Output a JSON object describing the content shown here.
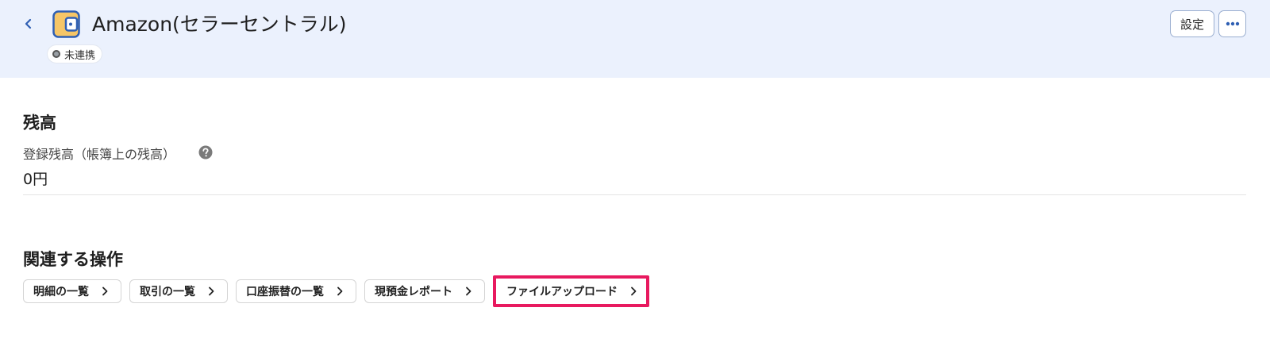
{
  "header": {
    "title": "Amazon(セラーセントラル)",
    "status": "未連携",
    "settings_label": "設定",
    "icons": {
      "back": "chevron-left-icon",
      "app": "wallet-icon",
      "more": "more-horizontal-icon"
    },
    "colors": {
      "background": "#ebf1fd",
      "accent": "#2f5fb3",
      "wallet": "#f6c667"
    }
  },
  "balance": {
    "section_title": "残高",
    "label": "登録残高（帳簿上の残高）",
    "value": "0円"
  },
  "related": {
    "section_title": "関連する操作",
    "actions": [
      {
        "label": "明細の一覧"
      },
      {
        "label": "取引の一覧"
      },
      {
        "label": "口座振替の一覧"
      },
      {
        "label": "現預金レポート"
      },
      {
        "label": "ファイルアップロード"
      }
    ],
    "highlight_color": "#e8195f"
  }
}
